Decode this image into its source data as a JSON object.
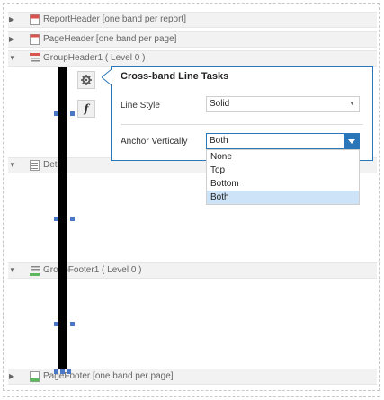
{
  "bands": {
    "report_header": "ReportHeader [one band per report]",
    "page_header": "PageHeader [one band per page]",
    "group_header": "GroupHeader1 ( Level 0 )",
    "detail": "Detail",
    "group_footer": "GroupFooter1 ( Level 0 )",
    "page_footer": "PageFooter [one band per page]"
  },
  "tools": {
    "smart_tag_icon": "gear-icon",
    "expression_glyph": "f"
  },
  "popup": {
    "title": "Cross-band Line Tasks",
    "line_style_label": "Line Style",
    "line_style_value": "Solid",
    "anchor_label": "Anchor Vertically",
    "anchor_value": "Both",
    "anchor_options": [
      "None",
      "Top",
      "Bottom",
      "Both"
    ]
  },
  "colors": {
    "accent": "#2b76b8",
    "selection": "#cde3f7",
    "handle": "#4b78c6"
  }
}
